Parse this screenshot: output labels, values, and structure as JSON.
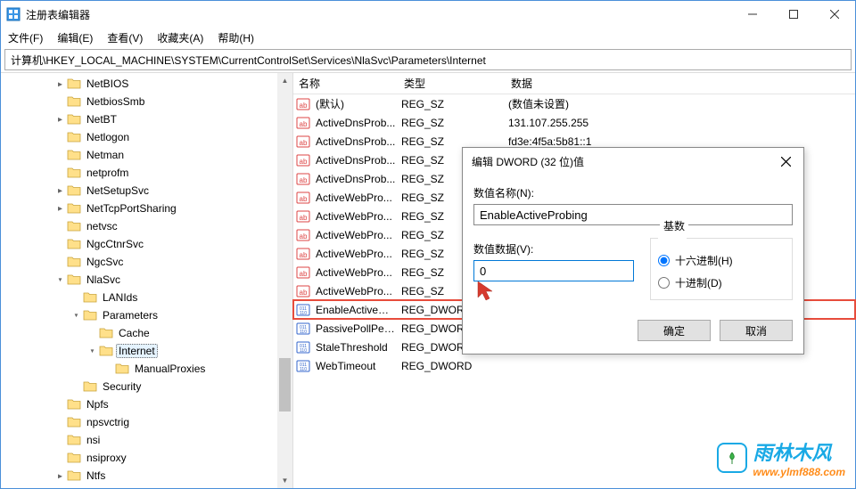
{
  "window": {
    "title": "注册表编辑器",
    "address": "计算机\\HKEY_LOCAL_MACHINE\\SYSTEM\\CurrentControlSet\\Services\\NlaSvc\\Parameters\\Internet"
  },
  "menu": {
    "file": "文件(F)",
    "edit": "编辑(E)",
    "view": "查看(V)",
    "favorites": "收藏夹(A)",
    "help": "帮助(H)"
  },
  "tree": {
    "items": [
      {
        "indent": 3,
        "exp": ">",
        "label": "NetBIOS"
      },
      {
        "indent": 3,
        "exp": "",
        "label": "NetbiosSmb"
      },
      {
        "indent": 3,
        "exp": ">",
        "label": "NetBT"
      },
      {
        "indent": 3,
        "exp": "",
        "label": "Netlogon"
      },
      {
        "indent": 3,
        "exp": "",
        "label": "Netman"
      },
      {
        "indent": 3,
        "exp": "",
        "label": "netprofm"
      },
      {
        "indent": 3,
        "exp": ">",
        "label": "NetSetupSvc"
      },
      {
        "indent": 3,
        "exp": ">",
        "label": "NetTcpPortSharing"
      },
      {
        "indent": 3,
        "exp": "",
        "label": "netvsc"
      },
      {
        "indent": 3,
        "exp": "",
        "label": "NgcCtnrSvc"
      },
      {
        "indent": 3,
        "exp": "",
        "label": "NgcSvc"
      },
      {
        "indent": 3,
        "exp": "v",
        "label": "NlaSvc"
      },
      {
        "indent": 4,
        "exp": "",
        "label": "LANIds"
      },
      {
        "indent": 4,
        "exp": "v",
        "label": "Parameters"
      },
      {
        "indent": 5,
        "exp": "",
        "label": "Cache"
      },
      {
        "indent": 5,
        "exp": "v",
        "label": "Internet",
        "selected": true
      },
      {
        "indent": 6,
        "exp": "",
        "label": "ManualProxies"
      },
      {
        "indent": 4,
        "exp": "",
        "label": "Security"
      },
      {
        "indent": 3,
        "exp": "",
        "label": "Npfs"
      },
      {
        "indent": 3,
        "exp": "",
        "label": "npsvctrig"
      },
      {
        "indent": 3,
        "exp": "",
        "label": "nsi"
      },
      {
        "indent": 3,
        "exp": "",
        "label": "nsiproxy"
      },
      {
        "indent": 3,
        "exp": ">",
        "label": "Ntfs"
      }
    ]
  },
  "list": {
    "headers": {
      "name": "名称",
      "type": "类型",
      "data": "数据"
    },
    "rows": [
      {
        "icon": "str",
        "name": "(默认)",
        "type": "REG_SZ",
        "data": "(数值未设置)"
      },
      {
        "icon": "str",
        "name": "ActiveDnsProb...",
        "type": "REG_SZ",
        "data": "131.107.255.255"
      },
      {
        "icon": "str",
        "name": "ActiveDnsProb...",
        "type": "REG_SZ",
        "data": "fd3e:4f5a:5b81::1"
      },
      {
        "icon": "str",
        "name": "ActiveDnsProb...",
        "type": "REG_SZ",
        "data": ""
      },
      {
        "icon": "str",
        "name": "ActiveDnsProb...",
        "type": "REG_SZ",
        "data": ""
      },
      {
        "icon": "str",
        "name": "ActiveWebPro...",
        "type": "REG_SZ",
        "data": ""
      },
      {
        "icon": "str",
        "name": "ActiveWebPro...",
        "type": "REG_SZ",
        "data": ""
      },
      {
        "icon": "str",
        "name": "ActiveWebPro...",
        "type": "REG_SZ",
        "data": ""
      },
      {
        "icon": "str",
        "name": "ActiveWebPro...",
        "type": "REG_SZ",
        "data": ""
      },
      {
        "icon": "str",
        "name": "ActiveWebPro...",
        "type": "REG_SZ",
        "data": ""
      },
      {
        "icon": "str",
        "name": "ActiveWebPro...",
        "type": "REG_SZ",
        "data": ""
      },
      {
        "icon": "num",
        "name": "EnableActivePr...",
        "type": "REG_DWORD",
        "data": "",
        "highlight": true
      },
      {
        "icon": "num",
        "name": "PassivePollPeri...",
        "type": "REG_DWORD",
        "data": ""
      },
      {
        "icon": "num",
        "name": "StaleThreshold",
        "type": "REG_DWORD",
        "data": ""
      },
      {
        "icon": "num",
        "name": "WebTimeout",
        "type": "REG_DWORD",
        "data": ""
      }
    ]
  },
  "dialog": {
    "title": "编辑 DWORD (32 位)值",
    "name_label": "数值名称(N):",
    "name_value": "EnableActiveProbing",
    "data_label": "数值数据(V):",
    "data_value": "0",
    "base_label": "基数",
    "hex_label": "十六进制(H)",
    "dec_label": "十进制(D)",
    "ok": "确定",
    "cancel": "取消"
  },
  "watermark": {
    "cn": "雨林木风",
    "en": "www.ylmf888.com"
  }
}
